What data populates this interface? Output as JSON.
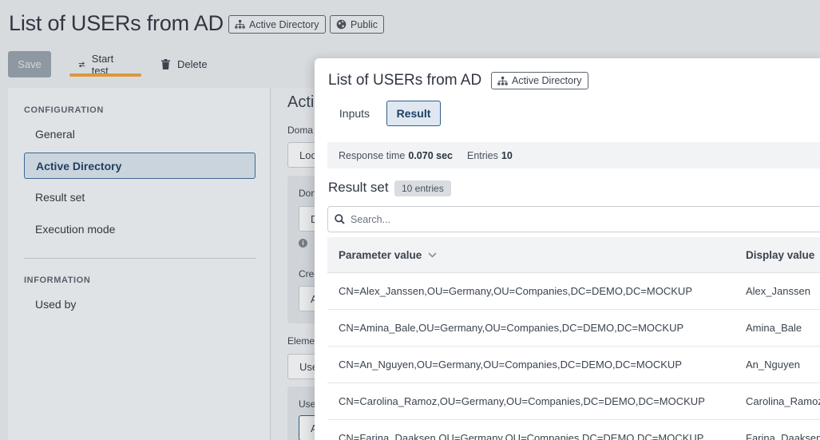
{
  "page": {
    "title": "List of USERs from AD",
    "badges": [
      "Active Directory",
      "Public"
    ],
    "toolbar": {
      "save": "Save",
      "start_test": "Start test",
      "delete": "Delete"
    }
  },
  "sidebar": {
    "configuration_label": "CONFIGURATION",
    "information_label": "INFORMATION",
    "items": [
      "General",
      "Active Directory",
      "Result set",
      "Execution mode"
    ],
    "info_items": [
      "Used by"
    ],
    "active_item": "Active Directory"
  },
  "main_peek": {
    "heading": "Acti",
    "labels": [
      "Doma",
      "Don",
      "Crec",
      "Eleme",
      "Use"
    ],
    "inputs": [
      "Loc",
      "D",
      "A",
      "Use",
      "A"
    ]
  },
  "modal": {
    "title": "List of USERs from AD",
    "badge": "Active Directory",
    "tabs": [
      "Inputs",
      "Result"
    ],
    "active_tab": "Result",
    "stats": {
      "response_label": "Response time",
      "response_value": "0.070 sec",
      "entries_label": "Entries",
      "entries_value": "10"
    },
    "result_set_title": "Result set",
    "result_count": "10 entries",
    "search_placeholder": "Search...",
    "columns": [
      "Parameter value",
      "Display value"
    ],
    "rows": [
      [
        "CN=Alex_Janssen,OU=Germany,OU=Companies,DC=DEMO,DC=MOCKUP",
        "Alex_Janssen"
      ],
      [
        "CN=Amina_Bale,OU=Germany,OU=Companies,DC=DEMO,DC=MOCKUP",
        "Amina_Bale"
      ],
      [
        "CN=An_Nguyen,OU=Germany,OU=Companies,DC=DEMO,DC=MOCKUP",
        "An_Nguyen"
      ],
      [
        "CN=Carolina_Ramoz,OU=Germany,OU=Companies,DC=DEMO,DC=MOCKUP",
        "Carolina_Ramoz"
      ],
      [
        "CN=Farina_Daaksen,OU=Germany,OU=Companies,DC=DEMO,DC=MOCKUP",
        "Farina_Daaksen"
      ]
    ]
  },
  "colors": {
    "accent": "#f2a33a",
    "primary": "#2f5f8e",
    "active_bg": "#dfe8f1",
    "save_disabled": "#9aa3ad"
  },
  "icons": [
    "hierarchy-icon",
    "globe-icon",
    "swap-arrows-icon",
    "trash-icon",
    "search-icon",
    "chevron-down-icon",
    "info-icon"
  ]
}
